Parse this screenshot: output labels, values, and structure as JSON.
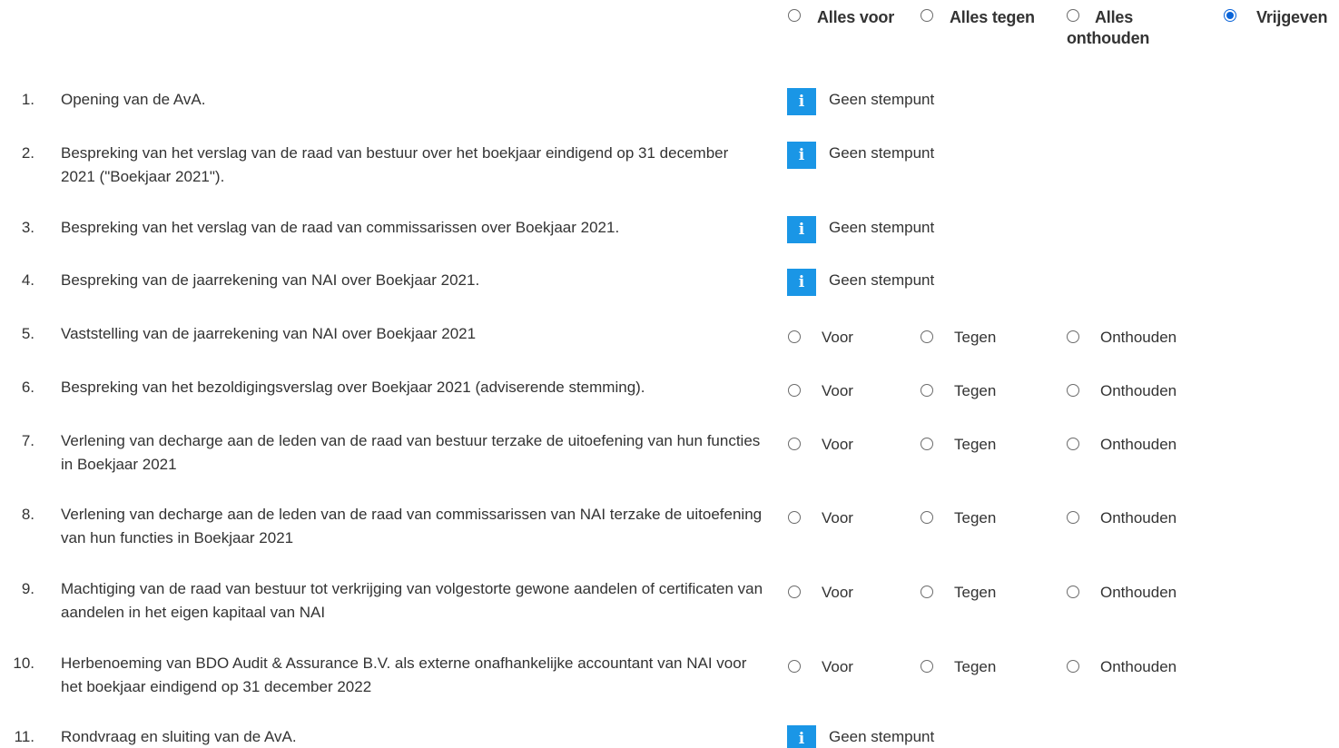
{
  "header": {
    "all_for": "Alles voor",
    "all_against": "Alles tegen",
    "all_abstain": "Alles onthouden",
    "release": "Vrijgeven",
    "selected": "release"
  },
  "vote_labels": {
    "for": "Voor",
    "against": "Tegen",
    "abstain": "Onthouden"
  },
  "no_vote_label": "Geen stempunt",
  "info_icon_glyph": "i",
  "colors": {
    "info_icon_bg": "#1a96e6",
    "radio_checked": "#0a64d8",
    "text": "#333333"
  },
  "agenda": [
    {
      "number": "1.",
      "text": "Opening van de AvA.",
      "votable": false
    },
    {
      "number": "2.",
      "text": "Bespreking van het verslag van de raad van bestuur over het boekjaar eindigend op 31 december 2021 (\"Boekjaar 2021\").",
      "votable": false
    },
    {
      "number": "3.",
      "text": "Bespreking van het verslag van de raad van commissarissen over Boekjaar 2021.",
      "votable": false
    },
    {
      "number": "4.",
      "text": "Bespreking van de jaarrekening van NAI over Boekjaar 2021.",
      "votable": false
    },
    {
      "number": "5.",
      "text": "Vaststelling van de jaarrekening van NAI over Boekjaar 2021",
      "votable": true
    },
    {
      "number": "6.",
      "text": "Bespreking van het bezoldigingsverslag over Boekjaar 2021 (adviserende stemming).",
      "votable": true
    },
    {
      "number": "7.",
      "text": "Verlening van decharge aan de leden van de raad van bestuur terzake de uitoefening van hun functies in Boekjaar 2021",
      "votable": true
    },
    {
      "number": "8.",
      "text": "Verlening van decharge aan de leden van de raad van commissarissen van NAI terzake de uitoefening van hun functies in Boekjaar 2021",
      "votable": true
    },
    {
      "number": "9.",
      "text": "Machtiging van de raad van bestuur tot verkrijging van volgestorte gewone aandelen of certificaten van aandelen in het eigen kapitaal van NAI",
      "votable": true
    },
    {
      "number": "10.",
      "text": "Herbenoeming van BDO Audit & Assurance B.V. als externe onafhankelijke accountant van NAI voor het boekjaar eindigend op 31 december 2022",
      "votable": true
    },
    {
      "number": "11.",
      "text": "Rondvraag en sluiting van de AvA.",
      "votable": false
    }
  ]
}
